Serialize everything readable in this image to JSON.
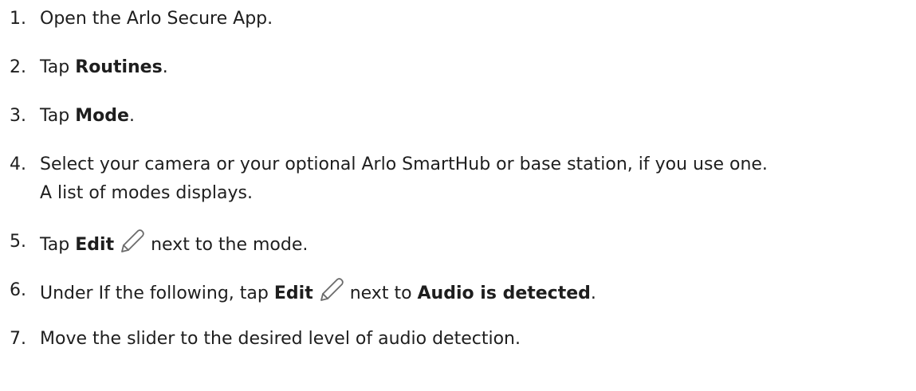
{
  "steps": [
    {
      "number": "1.",
      "text": "Open the Arlo Secure App."
    },
    {
      "number": "2.",
      "prefix": "Tap ",
      "bold": "Routines",
      "suffix": "."
    },
    {
      "number": "3.",
      "prefix": "Tap ",
      "bold": "Mode",
      "suffix": "."
    },
    {
      "number": "4.",
      "line1": "Select your camera or your optional Arlo SmartHub or base station, if you use one.",
      "line2": "A list of modes displays."
    },
    {
      "number": "5.",
      "prefix": "Tap ",
      "bold": "Edit",
      "icon": "pencil-icon",
      "suffix": "next to the mode."
    },
    {
      "number": "6.",
      "prefix": "Under If the following, tap ",
      "bold": "Edit",
      "icon": "pencil-icon",
      "middle": "next to ",
      "bold2": "Audio is detected",
      "suffix": "."
    },
    {
      "number": "7.",
      "text": "Move the slider to the desired level of audio detection."
    }
  ],
  "colors": {
    "text": "#1e1e1e",
    "icon": "#6b6b6b"
  }
}
